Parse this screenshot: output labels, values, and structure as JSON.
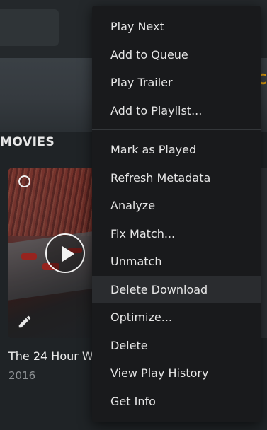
{
  "background": {
    "section_title": "MOVIES",
    "hero_edge_text": "C"
  },
  "card": {
    "title": "The 24 Hour W",
    "year": "2016",
    "icons": [
      "select-circle-icon",
      "play-icon",
      "pencil-icon"
    ]
  },
  "menu": {
    "group1": [
      {
        "label": "Play Next"
      },
      {
        "label": "Add to Queue"
      },
      {
        "label": "Play Trailer"
      },
      {
        "label": "Add to Playlist..."
      }
    ],
    "group2": [
      {
        "label": "Mark as Played"
      },
      {
        "label": "Refresh Metadata"
      },
      {
        "label": "Analyze"
      },
      {
        "label": "Fix Match..."
      },
      {
        "label": "Unmatch"
      },
      {
        "label": "Delete Download"
      },
      {
        "label": "Optimize..."
      },
      {
        "label": "Delete"
      },
      {
        "label": "View Play History"
      },
      {
        "label": "Get Info"
      }
    ],
    "highlighted": "Delete Download"
  },
  "colors": {
    "accent": "#e5a00d",
    "menu_bg": "#191a1c",
    "highlight_bg": "#2a2c2f"
  }
}
